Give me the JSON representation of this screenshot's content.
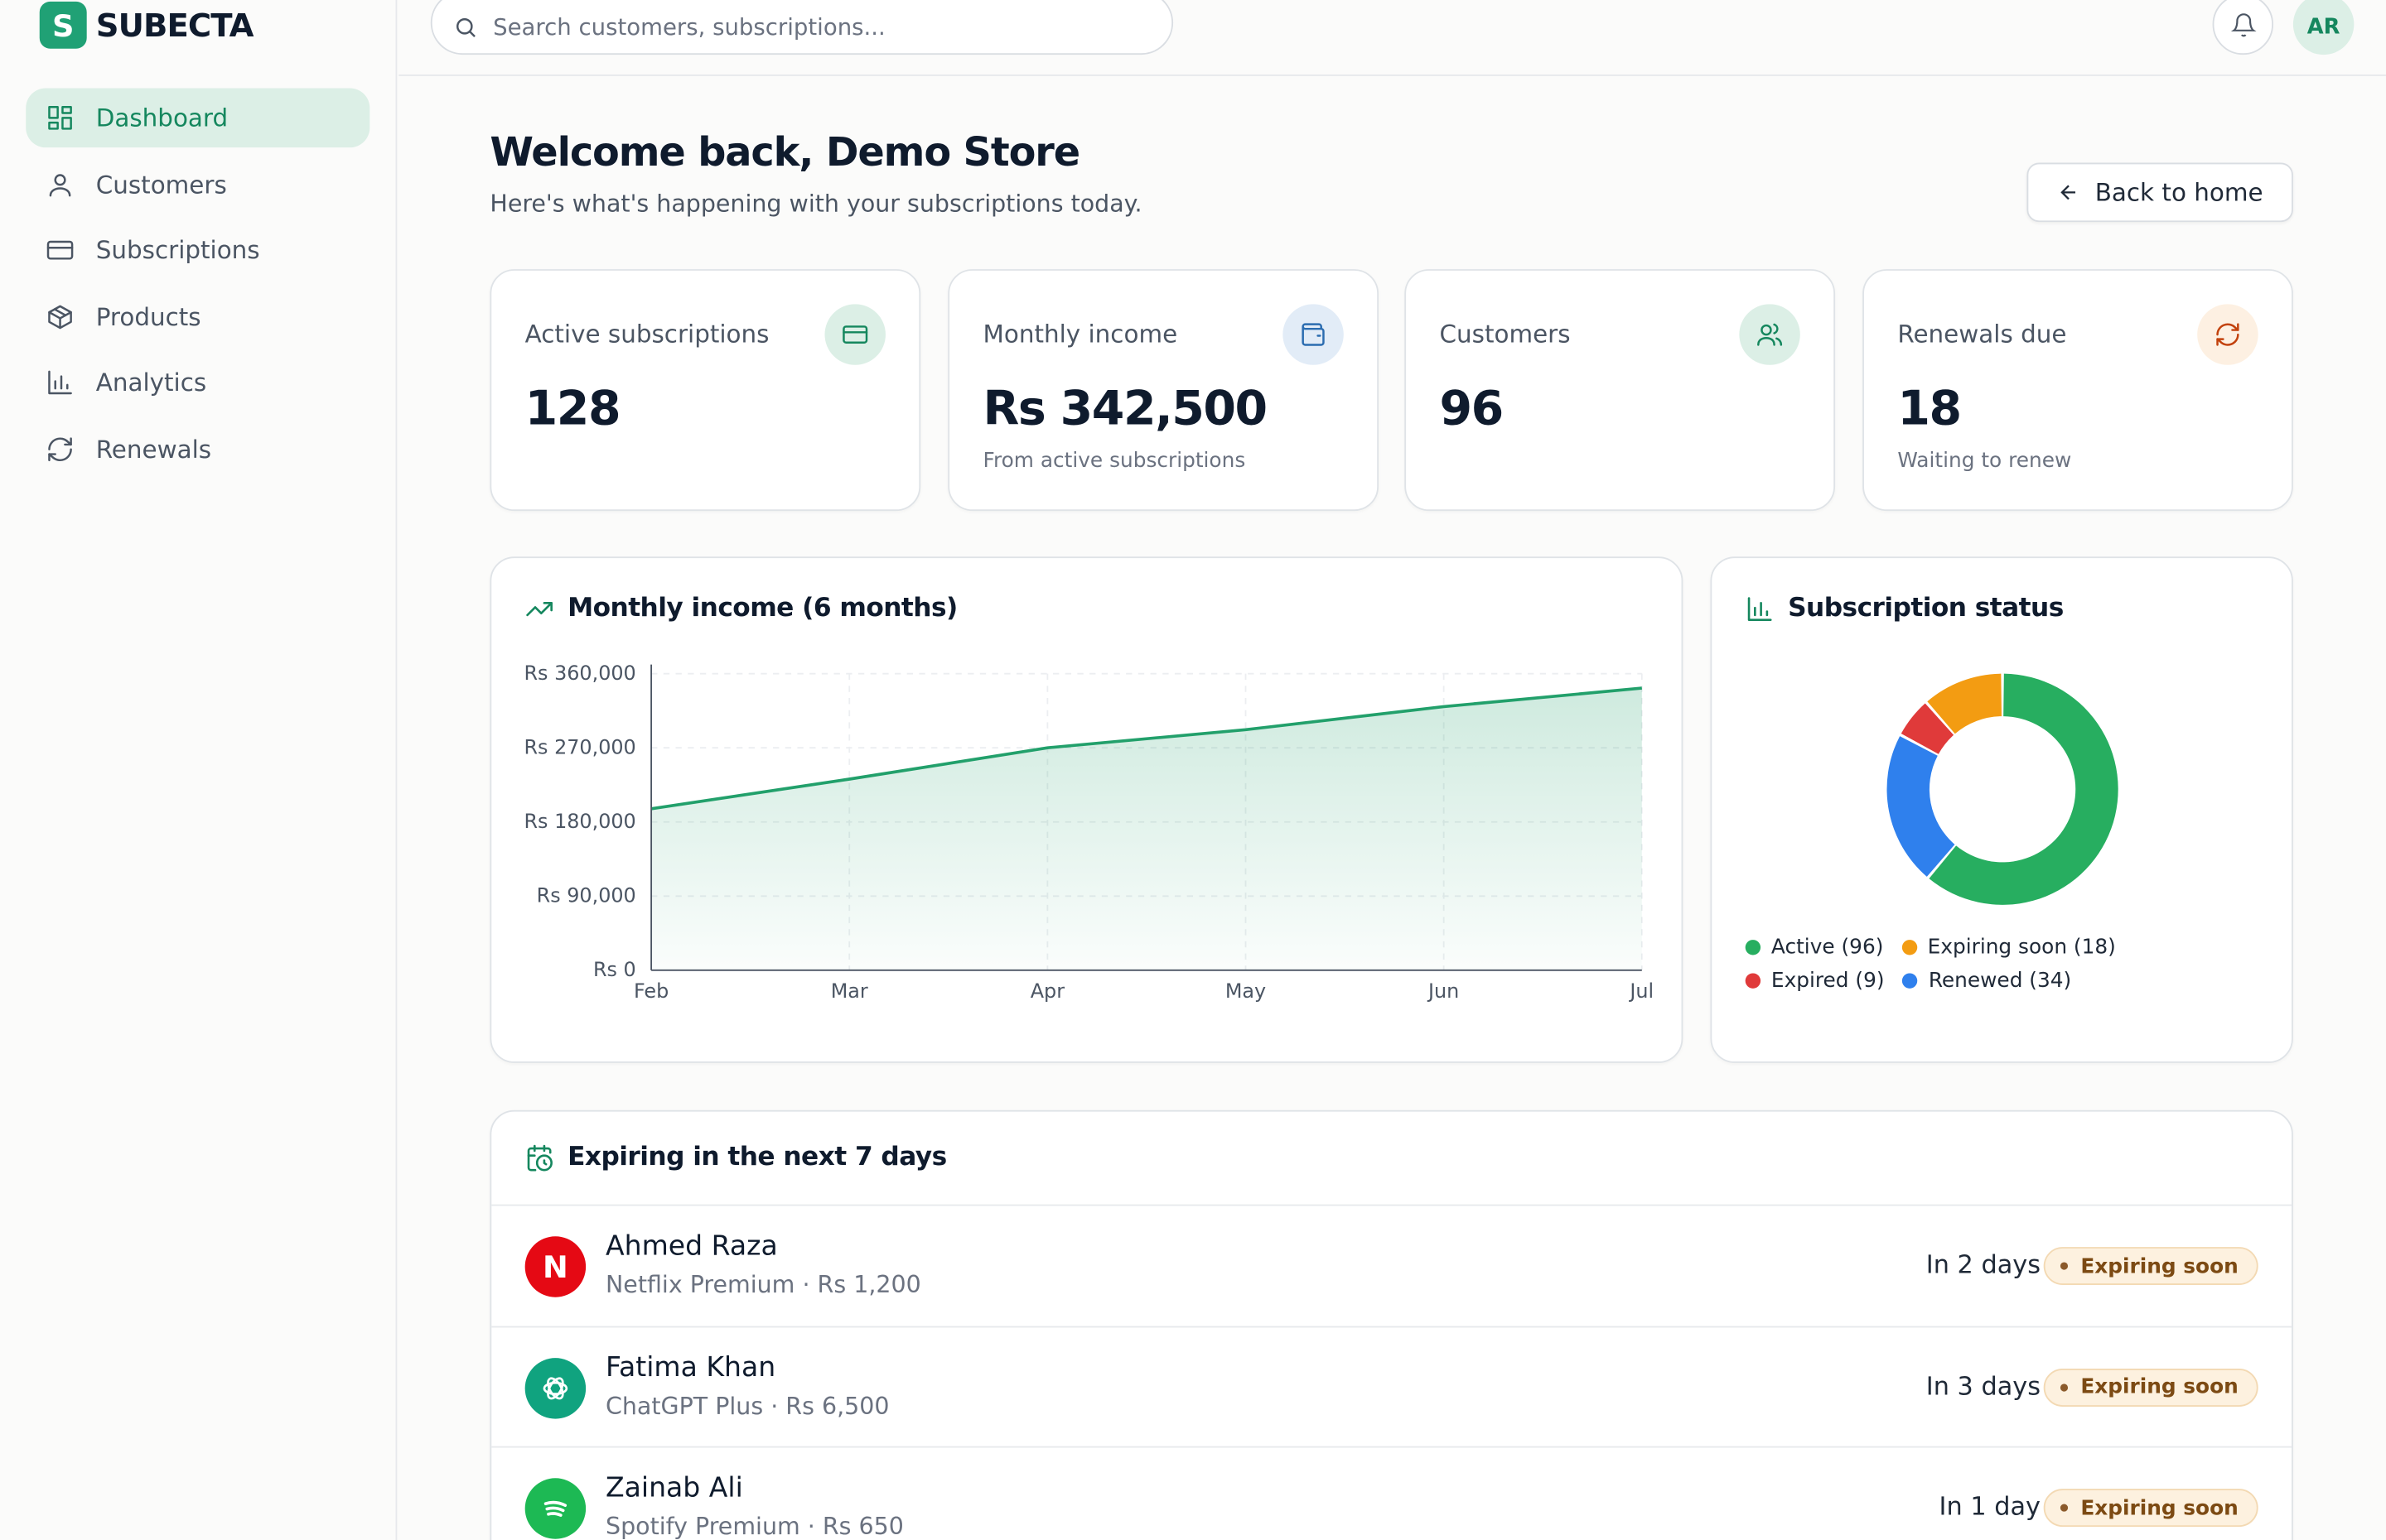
{
  "app": {
    "name": "SUBECTA",
    "logo_letter": "S"
  },
  "search": {
    "placeholder": "Search customers, subscriptions..."
  },
  "user": {
    "initials": "AR"
  },
  "sidebar": {
    "items": [
      {
        "label": "Dashboard",
        "icon": "dashboard-icon",
        "active": true
      },
      {
        "label": "Customers",
        "icon": "user-icon"
      },
      {
        "label": "Subscriptions",
        "icon": "card-icon"
      },
      {
        "label": "Products",
        "icon": "box-icon"
      },
      {
        "label": "Analytics",
        "icon": "bar-chart-icon"
      },
      {
        "label": "Renewals",
        "icon": "refresh-icon"
      }
    ]
  },
  "header": {
    "title": "Welcome back, Demo Store",
    "subtitle": "Here's what's happening with your subscriptions today.",
    "back_label": "Back to home"
  },
  "stats": [
    {
      "label": "Active subscriptions",
      "value": "128",
      "note": "",
      "icon": "card-icon",
      "color": "#15875e"
    },
    {
      "label": "Monthly income",
      "value": "Rs 342,500",
      "note": "From active subscriptions",
      "icon": "wallet-icon",
      "color": "#2b6cb0"
    },
    {
      "label": "Customers",
      "value": "96",
      "note": "",
      "icon": "users-icon",
      "color": "#15875e"
    },
    {
      "label": "Renewals due",
      "value": "18",
      "note": "Waiting to renew",
      "icon": "refresh-icon",
      "color": "#c2410c"
    }
  ],
  "income_chart": {
    "title": "Monthly income (6 months)",
    "icon": "trending-up-icon"
  },
  "status_chart": {
    "title": "Subscription status",
    "icon": "bar-chart-icon"
  },
  "chart_data": [
    {
      "type": "area",
      "title": "Monthly income (6 months)",
      "x": [
        "Feb",
        "Mar",
        "Apr",
        "May",
        "Jun",
        "Jul"
      ],
      "y_tick_labels": [
        "Rs 0",
        "Rs 90,000",
        "Rs 180,000",
        "Rs 270,000",
        "Rs 360,000"
      ],
      "values": [
        196000,
        232000,
        270000,
        292000,
        320000,
        342500
      ],
      "ylim": [
        0,
        360000
      ],
      "grid": true,
      "color": "#22a06b"
    },
    {
      "type": "pie",
      "title": "Subscription status",
      "donut": true,
      "slices": [
        {
          "label": "Active",
          "value": 96,
          "color": "#27ae60"
        },
        {
          "label": "Renewed",
          "value": 34,
          "color": "#2f80ed"
        },
        {
          "label": "Expired",
          "value": 9,
          "color": "#e03a3a"
        },
        {
          "label": "Expiring soon",
          "value": 18,
          "color": "#f39c12"
        }
      ],
      "legend": [
        {
          "label": "Active (96)",
          "color": "#27ae60"
        },
        {
          "label": "Expiring soon (18)",
          "color": "#f39c12"
        },
        {
          "label": "Expired (9)",
          "color": "#e03a3a"
        },
        {
          "label": "Renewed (34)",
          "color": "#2f80ed"
        }
      ],
      "legend_placement": "bottom"
    }
  ],
  "expiring": {
    "title": "Expiring in the next 7 days",
    "icon": "calendar-clock-icon",
    "rows": [
      {
        "name": "Ahmed Raza",
        "plan": "Netflix Premium · Rs 1,200",
        "days": "In 2 days",
        "badge": "Expiring soon",
        "app_icon": "netflix-icon",
        "app_letter": "N",
        "app_color": "#e50914"
      },
      {
        "name": "Fatima Khan",
        "plan": "ChatGPT Plus · Rs 6,500",
        "days": "In 3 days",
        "badge": "Expiring soon",
        "app_icon": "chatgpt-icon",
        "app_letter": "",
        "app_color": "#10a37f"
      },
      {
        "name": "Zainab Ali",
        "plan": "Spotify Premium · Rs 650",
        "days": "In 1 day",
        "badge": "Expiring soon",
        "app_icon": "spotify-icon",
        "app_letter": "",
        "app_color": "#1db954"
      }
    ]
  }
}
